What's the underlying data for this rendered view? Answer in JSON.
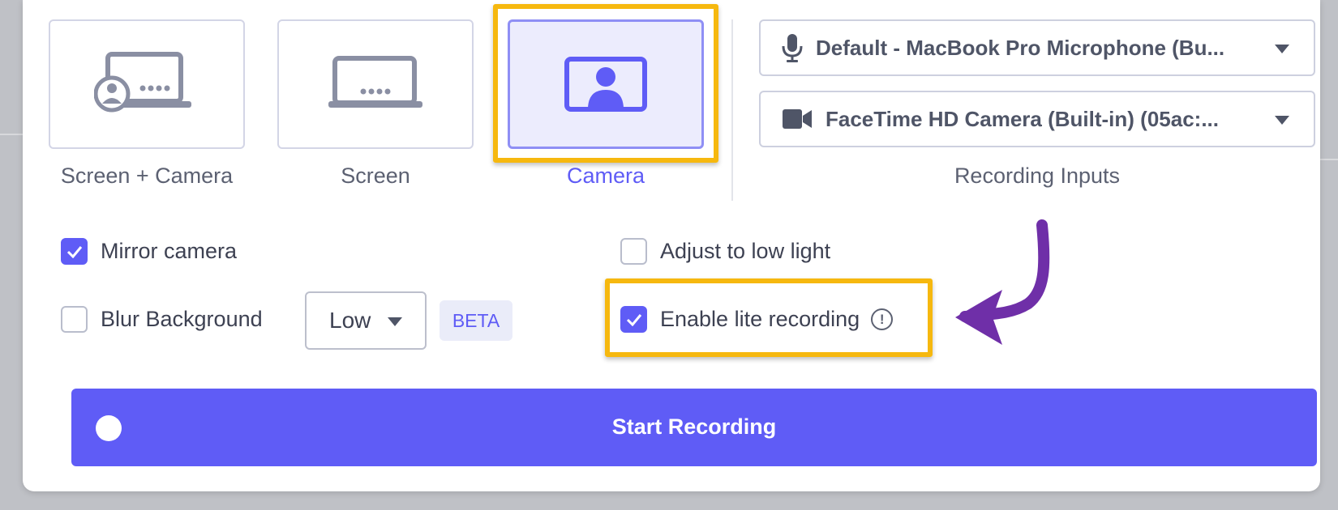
{
  "modes": [
    {
      "label": "Screen + Camera",
      "selected": false
    },
    {
      "label": "Screen",
      "selected": false
    },
    {
      "label": "Camera",
      "selected": true
    }
  ],
  "inputs": {
    "microphone": "Default - MacBook Pro Microphone (Bu...",
    "camera": "FaceTime HD Camera (Built-in) (05ac:...",
    "label": "Recording Inputs"
  },
  "options": {
    "mirror_camera": {
      "label": "Mirror camera",
      "checked": true
    },
    "blur_background": {
      "label": "Blur Background",
      "checked": false
    },
    "blur_level": "Low",
    "beta_badge": "BETA",
    "adjust_low_light": {
      "label": "Adjust to low light",
      "checked": false
    },
    "lite_recording": {
      "label": "Enable lite recording",
      "checked": true
    },
    "info_glyph": "!"
  },
  "start_button": "Start Recording",
  "colors": {
    "accent": "#5f5cf6",
    "highlight": "#f6b80f",
    "arrow": "#6f2fa8"
  }
}
